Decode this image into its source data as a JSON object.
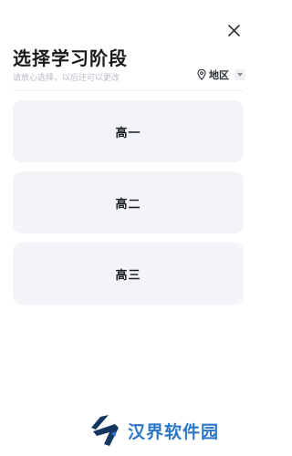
{
  "header": {
    "title": "选择学习阶段",
    "subtitle": "请放心选择，以后还可以更改",
    "close_icon": "close-icon"
  },
  "region": {
    "label": "地区",
    "icon": "location-pin-icon"
  },
  "grades": [
    {
      "label": "高一"
    },
    {
      "label": "高二"
    },
    {
      "label": "高三"
    }
  ],
  "watermark": {
    "text": "汉界软件园"
  },
  "colors": {
    "card_bg": "#f3f4f8",
    "watermark_blue": "#2c77c8",
    "subtitle_gray": "#b7bcc4"
  }
}
